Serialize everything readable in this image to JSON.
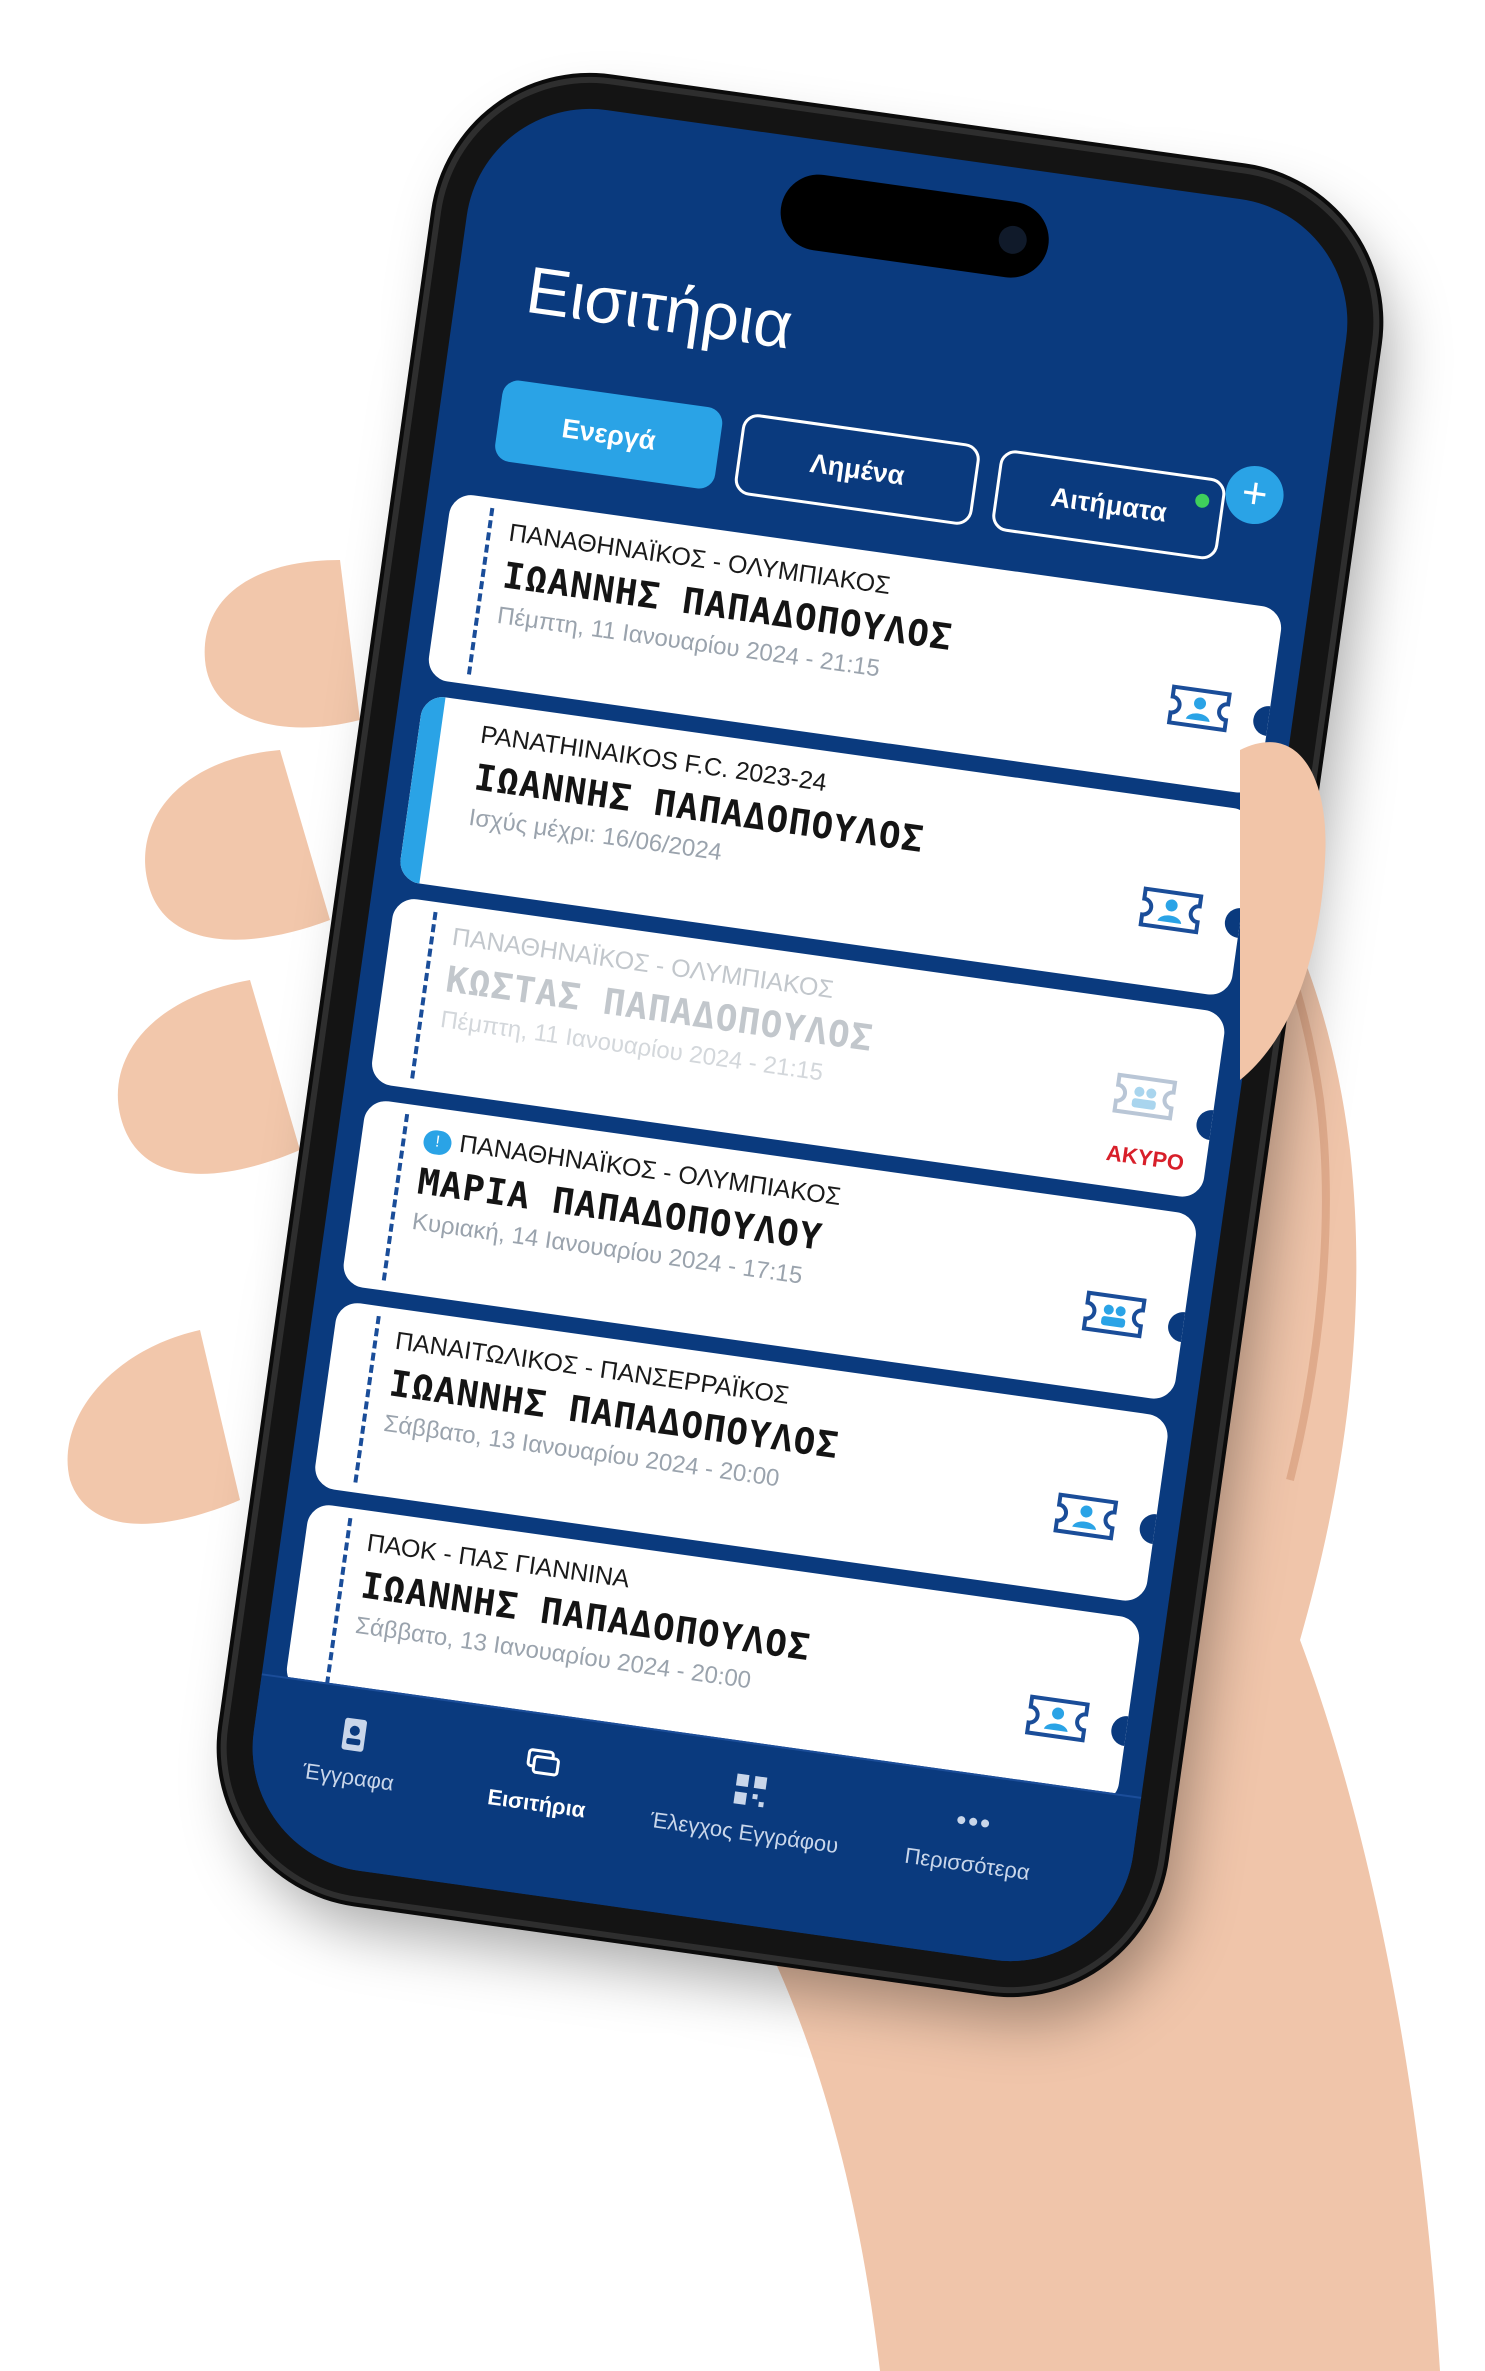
{
  "screen": {
    "title": "Εισιτήρια",
    "add_icon": "plus-icon",
    "add_symbol": "+"
  },
  "tabs": [
    {
      "label": "Ενεργά",
      "active": true
    },
    {
      "label": "Λημένα",
      "active": false
    },
    {
      "label": "Αιτήματα",
      "active": false,
      "has_badge_dot": true
    }
  ],
  "tickets": [
    {
      "match": "ΠΑΝΑΘΗΝΑΪΚΟΣ - ΟΛΥΜΠΙΑΚΟΣ",
      "holder": "ΙΩΑΝΝΗΣ ΠΑΠΑΔΟΠΟΥΛΟΣ",
      "when": "Πέμπτη, 11 Ιανουαρίου 2024 - 21:15",
      "icon": "ticket-person-icon"
    },
    {
      "match": "PANATHINAIKOS F.C. 2023-24",
      "holder": "ΙΩΑΝΝΗΣ ΠΑΠΑΔΟΠΟΥΛΟΣ",
      "when": "Ισχύς μέχρι: 16/06/2024",
      "icon": "ticket-person-icon",
      "accent": true
    },
    {
      "match": "ΠΑΝΑΘΗΝΑΪΚΟΣ - ΟΛΥΜΠΙΑΚΟΣ",
      "holder": "ΚΩΣΤΑΣ ΠΑΠΑΔΟΠΟΥΛΟΣ",
      "when": "Πέμπτη, 11 Ιανουαρίου 2024 - 21:15",
      "icon": "ticket-group-icon",
      "status": "ΑΚΥΡΟ",
      "void": true
    },
    {
      "match": "ΠΑΝΑΘΗΝΑΪΚΟΣ - ΟΛΥΜΠΙΑΚΟΣ",
      "holder": "ΜΑΡΙΑ ΠΑΠΑΔΟΠΟΥΛΟΥ",
      "when": "Κυριακή, 14 Ιανουαρίου 2024 - 17:15",
      "icon": "ticket-group-icon",
      "info": true
    },
    {
      "match": "ΠΑΝΑΙΤΩΛΙΚΟΣ - ΠΑΝΣΕΡΡΑΪΚΟΣ",
      "holder": "ΙΩΑΝΝΗΣ ΠΑΠΑΔΟΠΟΥΛΟΣ",
      "when": "Σάββατο, 13 Ιανουαρίου 2024 - 20:00",
      "icon": "ticket-person-icon"
    },
    {
      "match": "ΠΑΟΚ - ΠΑΣ ΓΙΑΝΝΙΝΑ",
      "holder": "ΙΩΑΝΝΗΣ ΠΑΠΑΔΟΠΟΥΛΟΣ",
      "when": "Σάββατο, 13 Ιανουαρίου 2024 - 20:00",
      "icon": "ticket-person-icon"
    }
  ],
  "nav": [
    {
      "label": "Έγγραφα",
      "icon": "id-card-icon",
      "active": false
    },
    {
      "label": "Εισιτήρια",
      "icon": "tickets-icon",
      "active": true
    },
    {
      "label": "Έλεγχος Εγγράφου",
      "icon": "qr-code-icon",
      "active": false
    },
    {
      "label": "Περισσότερα",
      "icon": "more-dots-icon",
      "active": false
    }
  ],
  "colors": {
    "screen_bg": "#0a3a7e",
    "accent": "#2aa3e6",
    "void_red": "#d81f2a",
    "badge_green": "#3fcf5b"
  }
}
